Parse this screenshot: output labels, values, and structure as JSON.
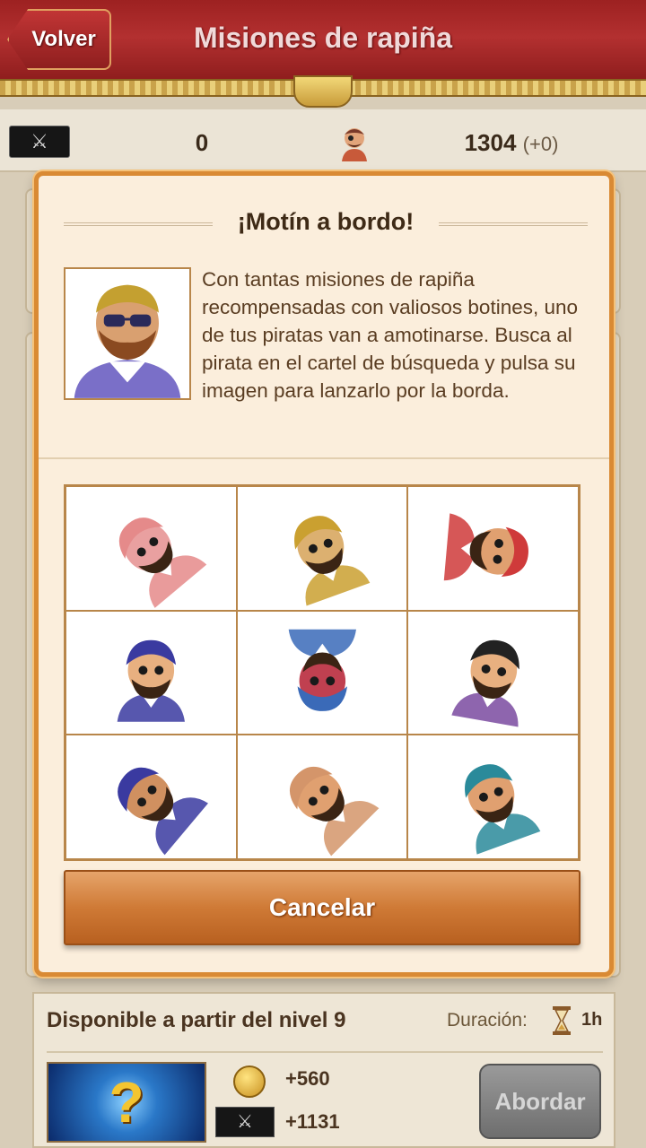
{
  "header": {
    "back_label": "Volver",
    "title": "Misiones de rapiña"
  },
  "stats": {
    "swords_icon": "crossed-swords-icon",
    "left_value": "0",
    "pirate_icon": "pirate-head-icon",
    "score": "1304",
    "score_delta": "(+0)"
  },
  "modal": {
    "title": "¡Motín a bordo!",
    "text": "Con tantas misiones de rapiña recompensadas con valiosos botines, uno de tus piratas van a amotinarse. Busca al pirata en el cartel de búsqueda y pulsa su imagen para lanzarlo por la borda.",
    "cancel_label": "Cancelar",
    "grid_cells": [
      {
        "hat": "#e58a8a",
        "skin": "#e9a0a0",
        "angle": 135,
        "rot": -40
      },
      {
        "hat": "#caa030",
        "skin": "#dcb070",
        "angle": 0,
        "rot": -20
      },
      {
        "hat": "#cf3a3a",
        "skin": "#e0a070",
        "angle": 90,
        "rot": 95
      },
      {
        "hat": "#3a3aa0",
        "skin": "#e8b080",
        "angle": 0,
        "rot": 0
      },
      {
        "hat": "#3a6ab8",
        "skin": "#c04050",
        "angle": 180,
        "rot": 180
      },
      {
        "hat": "#222222",
        "skin": "#e8b080",
        "angle": 0,
        "rot": 10
      },
      {
        "hat": "#3a3aa0",
        "skin": "#d09060",
        "angle": 135,
        "rot": -50
      },
      {
        "hat": "#d4956a",
        "skin": "#e0a070",
        "angle": 135,
        "rot": -45
      },
      {
        "hat": "#2a8a9a",
        "skin": "#e0a070",
        "angle": 0,
        "rot": -20
      }
    ]
  },
  "bottom_card": {
    "availability": "Disponible a partir del nivel 9",
    "duration_label": "Duración:",
    "duration_value": "1h",
    "mystery_symbol": "?",
    "reward_gold": "+560",
    "reward_fame": "+1131",
    "board_label": "Abordar"
  }
}
